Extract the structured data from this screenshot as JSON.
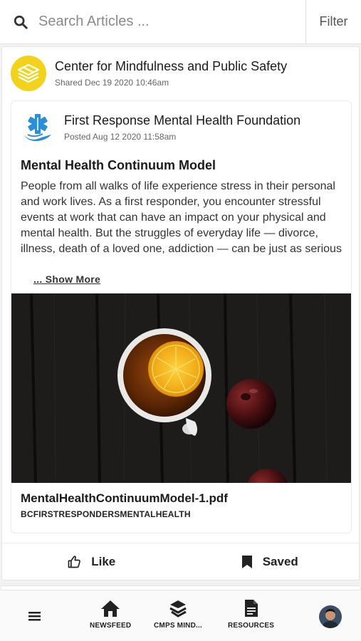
{
  "search": {
    "placeholder": "Search Articles ...",
    "value": ""
  },
  "filter_label": "Filter",
  "post": {
    "org_name": "Center for Mindfulness and Public Safety",
    "shared_date": "Shared Dec 19 2020 10:46am",
    "inner": {
      "org_name": "First Response Mental Health Foundation",
      "posted_date": "Posted Aug 12 2020 11:58am",
      "title": "Mental Health Continuum Model",
      "body": "People from all walks of life experience stress in their personal and work lives. As a first responder, you encounter stressful events at work that can have an impact on your physical and mental health. But the struggles of everyday life — divorce, illness, death of a loved one, addiction — can be just as serious",
      "show_more": "... Show More",
      "image_icon": "tea-and-apples-photo",
      "file_name": "MentalHealthContinuumModel-1.pdf",
      "file_tag": "BCFIRSTRESPONDERSMENTALHEALTH"
    },
    "actions": {
      "like": "Like",
      "saved": "Saved"
    }
  },
  "nav": {
    "menu_icon": "hamburger-icon",
    "items": [
      {
        "label": "NEWSFEED",
        "icon": "home-icon"
      },
      {
        "label": "CMPS MIND...",
        "icon": "cmps-logo-icon"
      },
      {
        "label": "RESOURCES",
        "icon": "document-icon"
      }
    ]
  },
  "colors": {
    "accent_yellow": "#f2d21b",
    "star_of_life_blue": "#2b8fd6"
  }
}
